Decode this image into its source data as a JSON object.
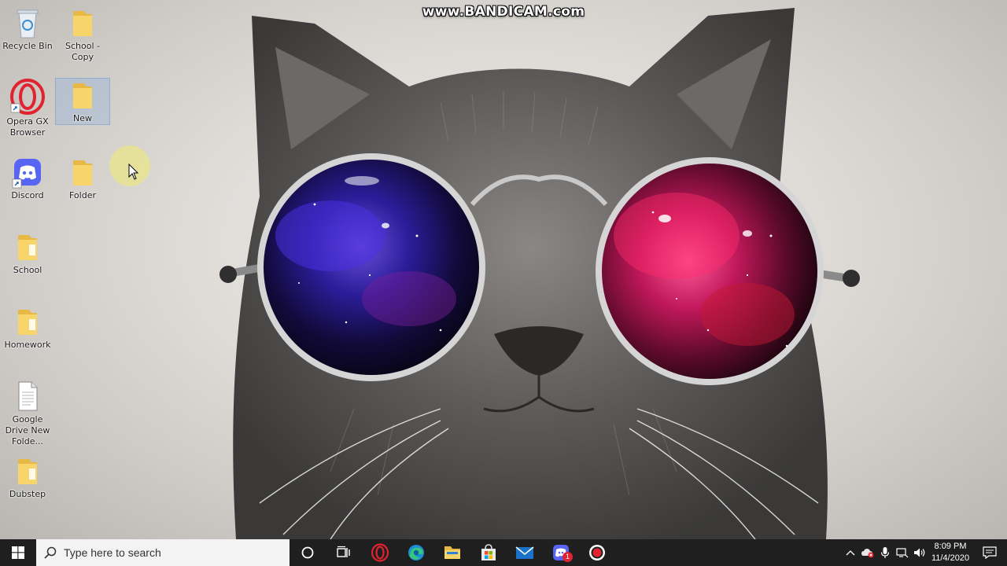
{
  "watermark": {
    "text": "www.BANDICAM.com"
  },
  "desktop_icons": [
    {
      "id": "recycle-bin",
      "label": "Recycle Bin",
      "icon": "recycle-bin-icon"
    },
    {
      "id": "school-copy",
      "label": "School - Copy",
      "icon": "folder-icon"
    },
    {
      "id": "opera-gx",
      "label": "Opera GX Browser",
      "icon": "opera-gx-icon"
    },
    {
      "id": "new-folder",
      "label": "New",
      "icon": "folder-icon",
      "selected": true
    },
    {
      "id": "discord",
      "label": "Discord",
      "icon": "discord-icon"
    },
    {
      "id": "folder",
      "label": "Folder",
      "icon": "folder-icon"
    },
    {
      "id": "school",
      "label": "School",
      "icon": "folder-icon"
    },
    {
      "id": "homework",
      "label": "Homework",
      "icon": "folder-icon"
    },
    {
      "id": "google-drive",
      "label": "Google Drive New Folde...",
      "icon": "document-icon"
    },
    {
      "id": "dubstep",
      "label": "Dubstep",
      "icon": "folder-icon"
    }
  ],
  "taskbar": {
    "search_placeholder": "Type here to search",
    "pinned": [
      "cortana-icon",
      "task-view-icon",
      "opera-gx-icon",
      "edge-icon",
      "file-explorer-icon",
      "microsoft-store-icon",
      "mail-icon",
      "discord-icon",
      "bandicam-record-icon"
    ],
    "discord_badge": "1"
  },
  "tray": {
    "time": "8:09 PM",
    "date": "11/4/2020"
  },
  "colors": {
    "taskbar": "#1f1f1f",
    "folder": "#f2c94c",
    "opera_red": "#e0232f",
    "discord": "#5865f2",
    "lens_left": "#3a2ab0",
    "lens_right": "#d02a6a"
  }
}
